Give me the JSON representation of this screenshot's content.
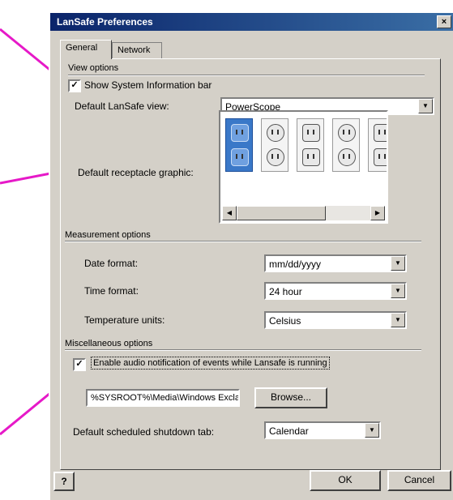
{
  "dialog": {
    "title": "LanSafe Preferences",
    "close_glyph": "×"
  },
  "tabs": [
    {
      "label": "General"
    },
    {
      "label": "Network"
    }
  ],
  "view_options": {
    "group_label": "View options",
    "show_sysinfo": {
      "label": "Show System Information bar",
      "checked": true,
      "mark": "✓"
    },
    "default_view": {
      "label": "Default LanSafe view:",
      "value": "PowerScope"
    },
    "receptacle": {
      "label": "Default receptacle graphic:"
    }
  },
  "measurement_options": {
    "group_label": "Measurement options",
    "date_format": {
      "label": "Date format:",
      "value": "mm/dd/yyyy"
    },
    "time_format": {
      "label": "Time format:",
      "value": "24 hour"
    },
    "temperature_units": {
      "label": "Temperature units:",
      "value": "Celsius"
    }
  },
  "misc_options": {
    "group_label": "Miscellaneous options",
    "audio_notify": {
      "label": "Enable audio notification of events while Lansafe is running",
      "checked": true,
      "mark": "✓"
    },
    "sound_file": "%SYSROOT%\\Media\\Windows Exclamation.WAV",
    "browse_label": "Browse...",
    "shutdown_tab": {
      "label": "Default scheduled shutdown tab:",
      "value": "Calendar"
    }
  },
  "buttons": {
    "help": "?",
    "ok": "OK",
    "cancel": "Cancel"
  },
  "icons": {
    "dropdown": "▼",
    "scroll_left": "◀",
    "scroll_right": "▶"
  },
  "colors": {
    "callout": "#e619c8",
    "title_bar": "#0a246a",
    "dialog_bg": "#d4d0c8",
    "selected_thumb": "#3a78c8"
  }
}
